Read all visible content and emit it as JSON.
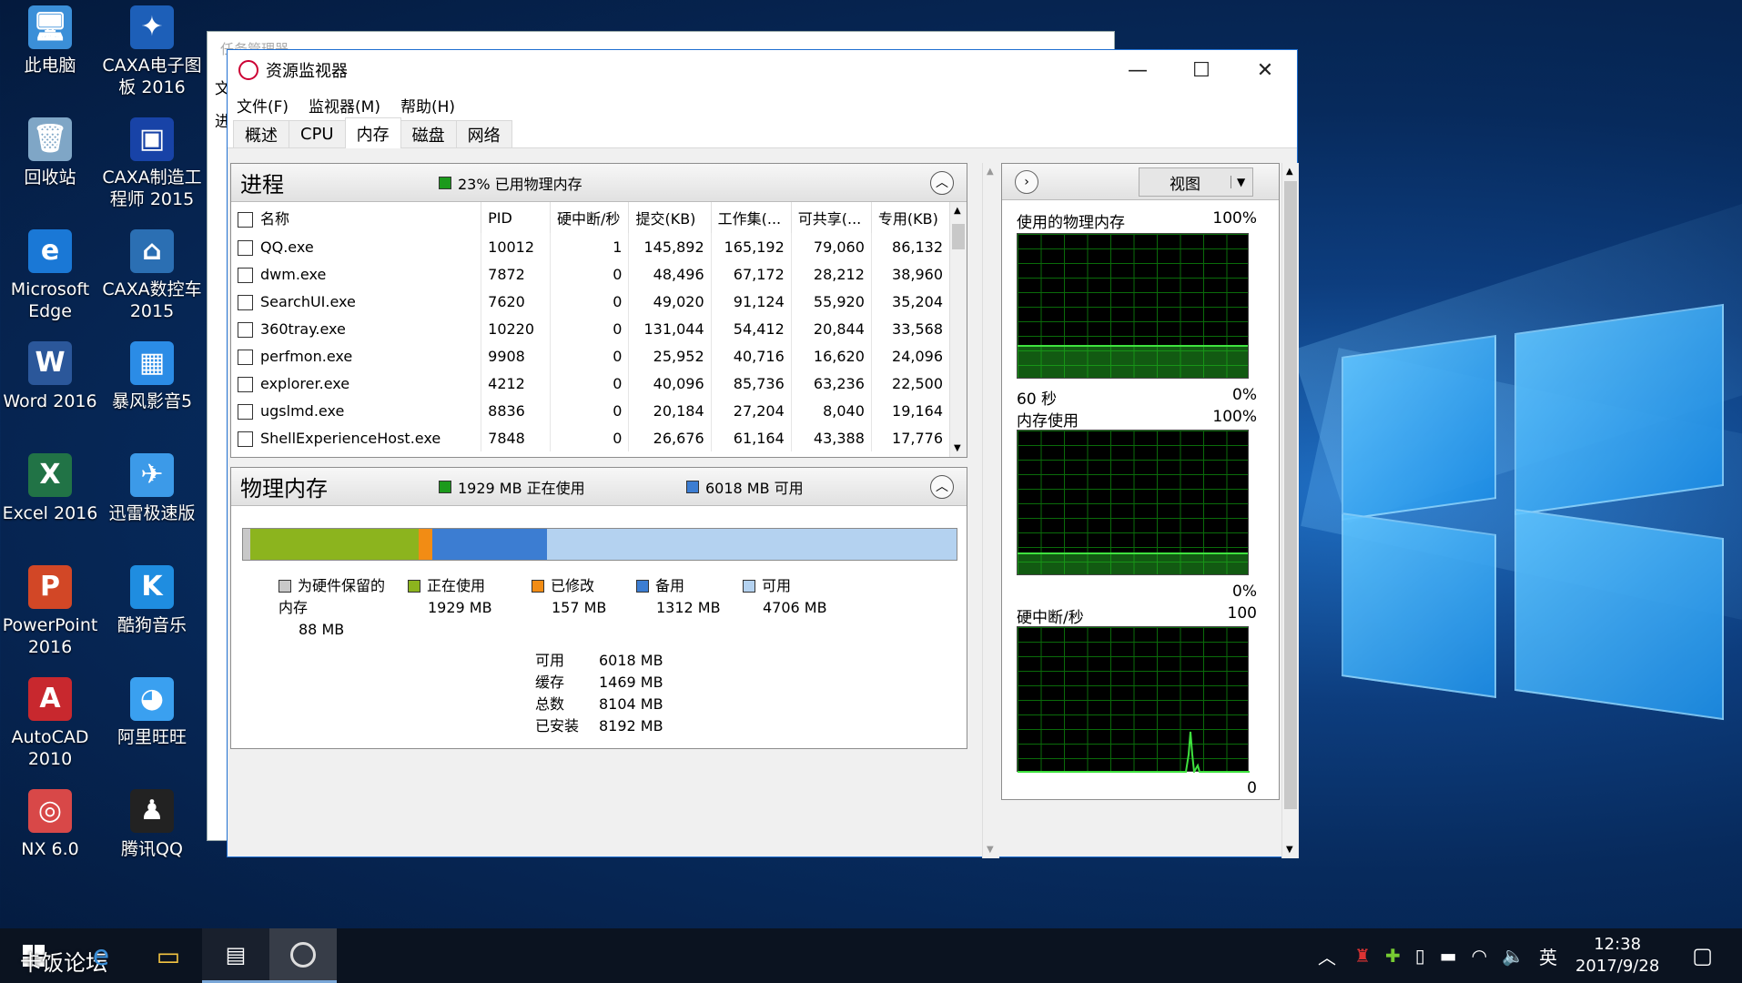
{
  "desktop": {
    "icons": [
      {
        "label": "此电脑",
        "glyph": "🖥",
        "color": "#3b8fd8"
      },
      {
        "label": "CAXA电子图板 2016",
        "glyph": "✦",
        "color": "#1d5fb8"
      },
      {
        "label": "回收站",
        "glyph": "🗑",
        "color": "#7fa6c6"
      },
      {
        "label": "CAXA制造工程师 2015",
        "glyph": "▣",
        "color": "#1843a7"
      },
      {
        "label": "Microsoft Edge",
        "glyph": "e",
        "color": "#1a78d6"
      },
      {
        "label": "CAXA数控车 2015",
        "glyph": "⌂",
        "color": "#2b6fb3"
      },
      {
        "label": "Word 2016",
        "glyph": "W",
        "color": "#2b579a"
      },
      {
        "label": "暴风影音5",
        "glyph": "▦",
        "color": "#2b8ce6"
      },
      {
        "label": "Excel 2016",
        "glyph": "X",
        "color": "#217346"
      },
      {
        "label": "迅雷极速版",
        "glyph": "✈",
        "color": "#3c9ae8"
      },
      {
        "label": "PowerPoint 2016",
        "glyph": "P",
        "color": "#d24726"
      },
      {
        "label": "酷狗音乐",
        "glyph": "K",
        "color": "#1f8de0"
      },
      {
        "label": "AutoCAD 2010",
        "glyph": "A",
        "color": "#c8282e"
      },
      {
        "label": "阿里旺旺",
        "glyph": "◕",
        "color": "#3aa0f0"
      },
      {
        "label": "NX 6.0",
        "glyph": "◎",
        "color": "#d84848"
      },
      {
        "label": "腾讯QQ",
        "glyph": "♟",
        "color": "#222"
      }
    ],
    "back_window_title": "任务管理器",
    "back_window_menu": [
      "文",
      "进"
    ]
  },
  "window": {
    "title": "资源监视器",
    "menu": [
      "文件(F)",
      "监视器(M)",
      "帮助(H)"
    ],
    "tabs": [
      "概述",
      "CPU",
      "内存",
      "磁盘",
      "网络"
    ],
    "active_tab": "内存"
  },
  "process": {
    "title": "进程",
    "summary": "23% 已用物理内存",
    "columns": [
      "名称",
      "PID",
      "硬中断/秒",
      "提交(KB)",
      "工作集(...",
      "可共享(...",
      "专用(KB)"
    ],
    "rows": [
      {
        "name": "QQ.exe",
        "pid": "10012",
        "hf": "1",
        "commit": "145,892",
        "ws": "165,192",
        "share": "79,060",
        "priv": "86,132"
      },
      {
        "name": "dwm.exe",
        "pid": "7872",
        "hf": "0",
        "commit": "48,496",
        "ws": "67,172",
        "share": "28,212",
        "priv": "38,960"
      },
      {
        "name": "SearchUI.exe",
        "pid": "7620",
        "hf": "0",
        "commit": "49,020",
        "ws": "91,124",
        "share": "55,920",
        "priv": "35,204"
      },
      {
        "name": "360tray.exe",
        "pid": "10220",
        "hf": "0",
        "commit": "131,044",
        "ws": "54,412",
        "share": "20,844",
        "priv": "33,568"
      },
      {
        "name": "perfmon.exe",
        "pid": "9908",
        "hf": "0",
        "commit": "25,952",
        "ws": "40,716",
        "share": "16,620",
        "priv": "24,096"
      },
      {
        "name": "explorer.exe",
        "pid": "4212",
        "hf": "0",
        "commit": "40,096",
        "ws": "85,736",
        "share": "63,236",
        "priv": "22,500"
      },
      {
        "name": "ugslmd.exe",
        "pid": "8836",
        "hf": "0",
        "commit": "20,184",
        "ws": "27,204",
        "share": "8,040",
        "priv": "19,164"
      },
      {
        "name": "ShellExperienceHost.exe",
        "pid": "7848",
        "hf": "0",
        "commit": "26,676",
        "ws": "61,164",
        "share": "43,388",
        "priv": "17,776"
      }
    ]
  },
  "physical": {
    "title": "物理内存",
    "in_use": "1929 MB 正在使用",
    "available": "6018 MB 可用",
    "bar_mb": {
      "reserved": 88,
      "in_use": 1929,
      "modified": 157,
      "standby": 1312,
      "free": 4706
    },
    "legend": [
      {
        "key": "reserved",
        "label": "为硬件保留的内存",
        "value": "88 MB",
        "color": "#c8c8c8"
      },
      {
        "key": "in_use",
        "label": "正在使用",
        "value": "1929 MB",
        "color": "#8cb41e"
      },
      {
        "key": "modified",
        "label": "已修改",
        "value": "157 MB",
        "color": "#f28c14"
      },
      {
        "key": "standby",
        "label": "备用",
        "value": "1312 MB",
        "color": "#3c7dd2"
      },
      {
        "key": "free",
        "label": "可用",
        "value": "4706 MB",
        "color": "#b4d2f0"
      }
    ],
    "stats": [
      {
        "k": "可用",
        "v": "6018 MB"
      },
      {
        "k": "缓存",
        "v": "1469 MB"
      },
      {
        "k": "总数",
        "v": "8104 MB"
      },
      {
        "k": "已安装",
        "v": "8192 MB"
      }
    ]
  },
  "graphs": {
    "view_label": "视图",
    "g1": {
      "title": "使用的物理内存",
      "max": "100%",
      "xlabel": "60 秒",
      "min": "0%",
      "level": 0.23
    },
    "g2": {
      "title": "内存使用",
      "max": "100%",
      "min": "0%",
      "level": 0.15
    },
    "g3": {
      "title": "硬中断/秒",
      "max": "100",
      "min": "0"
    }
  },
  "taskbar": {
    "overlay_text": "卡饭论坛",
    "ime": "英",
    "time": "12:38",
    "date": "2017/9/28"
  }
}
